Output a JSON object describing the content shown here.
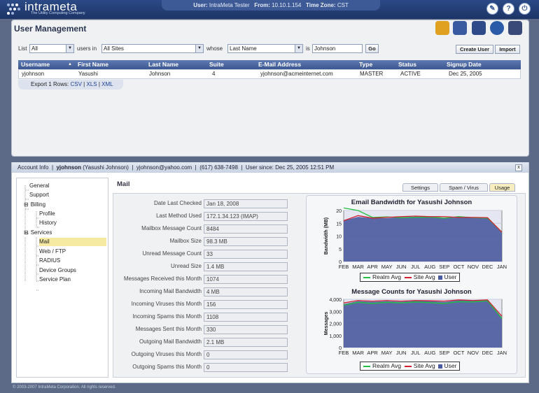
{
  "app": {
    "logo_text": "intrameta",
    "tagline": "The Utility Computing Company"
  },
  "session": {
    "user_label": "User:",
    "user": "IntraMeta Tester",
    "from_label": "From:",
    "from": "10.10.1.154",
    "tz_label": "Time Zone:",
    "tz": "CST"
  },
  "top_icons": [
    "wrench-icon",
    "help-icon",
    "power-icon"
  ],
  "page": {
    "title": "User Management"
  },
  "header_icons": [
    "users-icon",
    "card-icon",
    "network-icon",
    "globe-icon",
    "gears-icon"
  ],
  "filter": {
    "list_label": "List",
    "list_value": "All",
    "users_in_label": "users in",
    "sites_value": "All Sites",
    "whose_label": "whose",
    "field_value": "Last Name",
    "is_label": "is",
    "search_value": "Johnson",
    "go_label": "Go",
    "create_label": "Create User",
    "import_label": "Import"
  },
  "grid": {
    "columns": [
      "Username",
      "First Name",
      "Last Name",
      "Suite",
      "E-Mail Address",
      "Type",
      "Status",
      "Signup Date"
    ],
    "rows": [
      [
        "yjohnson",
        "Yasushi",
        "Johnson",
        "4",
        "yjohnson@acmeinternet.com",
        "MASTER",
        "ACTIVE",
        "Dec 25, 2005"
      ]
    ]
  },
  "export": {
    "prefix": "Export 1 Rows:",
    "csv": "CSV",
    "xls": "XLS",
    "xml": "XML",
    "sep": "|"
  },
  "account": {
    "label": "Account Info",
    "sep": "|",
    "username": "yjohnson",
    "fullname": "(Yasushi Johnson)",
    "email": "yjohnson@yahoo.com",
    "phone": "(617) 638-7498",
    "since": "User since: Dec 25, 2005 12:51 PM",
    "close": "x"
  },
  "tree": [
    {
      "label": "General",
      "level": 1
    },
    {
      "label": "Support",
      "level": 1
    },
    {
      "label": "Billing",
      "level": 0,
      "toggle": "⊟"
    },
    {
      "label": "Profile",
      "level": 2
    },
    {
      "label": "History",
      "level": 2
    },
    {
      "label": "Services",
      "level": 0,
      "toggle": "⊟"
    },
    {
      "label": "Mail",
      "level": 2,
      "selected": true
    },
    {
      "label": "Web / FTP",
      "level": 2
    },
    {
      "label": "RADIUS",
      "level": 2
    },
    {
      "label": "Device Groups",
      "level": 2
    },
    {
      "label": "Service Plan",
      "level": 2
    }
  ],
  "mail": {
    "title": "Mail",
    "tabs": [
      "Settings",
      "Spam / Virus",
      "Usage"
    ],
    "active_tab": "Usage",
    "fields": [
      {
        "label": "Date Last Checked",
        "value": "Jan 18, 2008"
      },
      {
        "label": "Last Method Used",
        "value": "172.1.34.123 (IMAP)"
      },
      {
        "label": "Mailbox Message Count",
        "value": "8484"
      },
      {
        "label": "Mailbox Size",
        "value": "98.3 MB"
      },
      {
        "label": "Unread Message Count",
        "value": "33"
      },
      {
        "label": "Unread Size",
        "value": "1.4 MB"
      },
      {
        "label": "Messages Received this Month",
        "value": "1074"
      },
      {
        "label": "Incoming Mail Bandwidth",
        "value": "4 MB"
      },
      {
        "label": "Incoming Viruses this Month",
        "value": "156"
      },
      {
        "label": "Incoming Spams this Month",
        "value": "1108"
      },
      {
        "label": "Messages Sent this Month",
        "value": "330"
      },
      {
        "label": "Outgoing Mail Bandwidth",
        "value": "2.1 MB"
      },
      {
        "label": "Outgoing Viruses this Month",
        "value": "0"
      },
      {
        "label": "Outgoing Spams this Month",
        "value": "0"
      }
    ]
  },
  "chart_data": [
    {
      "type": "area",
      "title": "Email Bandwidth for Yasushi Johnson",
      "xlabel": "",
      "ylabel": "Bandwidth (MB)",
      "categories": [
        "FEB",
        "MAR",
        "APR",
        "MAY",
        "JUN",
        "JUL",
        "AUG",
        "SEP",
        "OCT",
        "NOV",
        "DEC",
        "JAN"
      ],
      "ylim": [
        0,
        20
      ],
      "yticks": [
        0,
        5,
        10,
        15,
        20
      ],
      "series": [
        {
          "name": "Realm Avg",
          "color": "#22c040",
          "values": [
            21,
            20,
            17.3,
            17.5,
            17.2,
            17.3,
            17.4,
            17,
            17.6,
            17.2,
            17,
            11.5
          ]
        },
        {
          "name": "Site Avg",
          "color": "#d02030",
          "values": [
            16,
            18,
            17,
            17.3,
            17.6,
            17.8,
            17.6,
            17.6,
            17.3,
            17.3,
            17.2,
            11.5
          ]
        },
        {
          "name": "User",
          "color": "#4a5aa0",
          "values": [
            16,
            17.5,
            17,
            17,
            17.4,
            17.6,
            17.6,
            17.2,
            17.2,
            17.2,
            17.2,
            11.2
          ]
        }
      ],
      "legend": "bottom"
    },
    {
      "type": "area",
      "title": "Message Counts for Yasushi Johnson",
      "xlabel": "",
      "ylabel": "Messages",
      "categories": [
        "FEB",
        "MAR",
        "APR",
        "MAY",
        "JUN",
        "JUL",
        "AUG",
        "SEP",
        "OCT",
        "NOV",
        "DEC",
        "JAN"
      ],
      "ylim": [
        0,
        4000
      ],
      "yticks": [
        0,
        1000,
        2000,
        3000,
        4000
      ],
      "ytick_labels": [
        "0",
        "1,000",
        "2,000",
        "3,000",
        "4,000"
      ],
      "series": [
        {
          "name": "Realm Avg",
          "color": "#22c040",
          "values": [
            3500,
            3750,
            3650,
            3750,
            3700,
            3780,
            3720,
            3650,
            3800,
            3780,
            3880,
            2400
          ]
        },
        {
          "name": "Site Avg",
          "color": "#d02030",
          "values": [
            3700,
            3900,
            3850,
            3900,
            3850,
            3900,
            3880,
            3850,
            3950,
            3900,
            3950,
            2600
          ]
        },
        {
          "name": "User",
          "color": "#4a5aa0",
          "values": [
            3600,
            3850,
            3800,
            3850,
            3800,
            3880,
            3850,
            3780,
            3920,
            3880,
            3920,
            2500
          ]
        }
      ],
      "legend": "bottom"
    }
  ],
  "footer": "© 2003-2007 IntraMeta Corporation.  All rights reserved."
}
